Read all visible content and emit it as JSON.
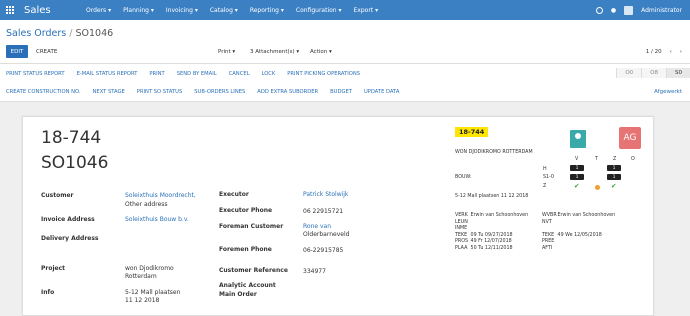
{
  "topbar": {
    "app_name": "Sales",
    "menu": [
      "Orders ▾",
      "Planning ▾",
      "Invoicing ▾",
      "Catalog ▾",
      "Reporting ▾",
      "Configuration ▾",
      "Export ▾"
    ],
    "user": "Administrator"
  },
  "breadcrumb": {
    "parent": "Sales Orders",
    "separator": "/",
    "current": "SO1046"
  },
  "toolbar": {
    "edit": "EDIT",
    "create": "CREATE",
    "print": "Print ▾",
    "attachments": "3 Attachment(s) ▾",
    "action": "Action ▾",
    "pager": "1 / 20",
    "prev": "‹",
    "next": "›"
  },
  "actions_row1": [
    "PRINT STATUS REPORT",
    "E-MAIL STATUS REPORT",
    "PRINT",
    "SEND BY EMAIL",
    "CANCEL",
    "LOCK",
    "PRINT PICKING OPERATIONS"
  ],
  "actions_row2": [
    "CREATE CONSTRUCTION NO.",
    "NEXT STAGE",
    "PRINT SO STATUS",
    "SUB-ORDERS LINES",
    "ADD EXTRA SUBORDER",
    "BUDGET",
    "UPDATE DATA"
  ],
  "stages": [
    "O0",
    "O8",
    "S0"
  ],
  "status_label": "Afgewerkt",
  "record": {
    "code": "18-744",
    "name": "SO1046",
    "customer_label": "Customer",
    "customer_value": "Soleixthuis Moordrecht,",
    "customer_value2": "Other address",
    "invoice_label": "Invoice Address",
    "invoice_value": "Soleixthuis Bouw b.v.",
    "delivery_label": "Delivery Address",
    "project_label": "Project",
    "project_value": "won Djodikromo",
    "project_value2": "Rotterdam",
    "info_label": "Info",
    "info_value": "5-12 Mall plaatsen",
    "info_value2": "11 12 2018",
    "executor_label": "Executor",
    "executor_value": "Patrick Stolwijk",
    "executor_phone_label": "Executor Phone",
    "executor_phone_value": "06 22915721",
    "foreman_label": "Foreman Customer",
    "foreman_value": "Rone van",
    "foreman_value2": "Olderbarneveld",
    "foremen_phone_label": "Foremen Phone",
    "foremen_phone_value": "06-22915785",
    "reference_label": "Customer Reference",
    "reference_value": "334977",
    "analytic_label": "Analytic Account",
    "main_order_label": "Main Order",
    "side_tag": "18-744",
    "side_title": "WON DJODIKROMO ROTTERDAM",
    "bouw_label": "BOUW:",
    "side_codes": [
      "H",
      "S1-0",
      "Z"
    ],
    "side_note": "5-12 Mall plaatsen 11 12 2018",
    "avatar_initials": "AG",
    "col_headers": [
      "V",
      "T",
      "Z",
      "O"
    ],
    "box_values": [
      "1",
      "1",
      "1",
      "1"
    ],
    "check_mark": "✔",
    "table_left": [
      [
        "VERK",
        "Erwin van Schoonhoven"
      ],
      [
        "LEUN",
        ""
      ],
      [
        "INME",
        ""
      ],
      [
        "TEKE",
        "09 Tu 09/27/2018"
      ],
      [
        "PROS",
        "49 Fr 12/07/2018"
      ],
      [
        "PLAA",
        "50 Tu 12/11/2018"
      ]
    ],
    "table_right": [
      [
        "WVBR",
        "Erwin van Schoonhoven"
      ],
      [
        "NVT",
        ""
      ],
      [
        "",
        ""
      ],
      [
        "TEKE",
        "49 We 12/05/2018"
      ],
      [
        "PREE",
        ""
      ],
      [
        "AFTI",
        ""
      ]
    ]
  },
  "colors": {
    "topbar": "#3c80c4",
    "accent": "#2a70b8",
    "tag": "#ffe600",
    "avatar": "#e67474",
    "check": "#35a035"
  }
}
